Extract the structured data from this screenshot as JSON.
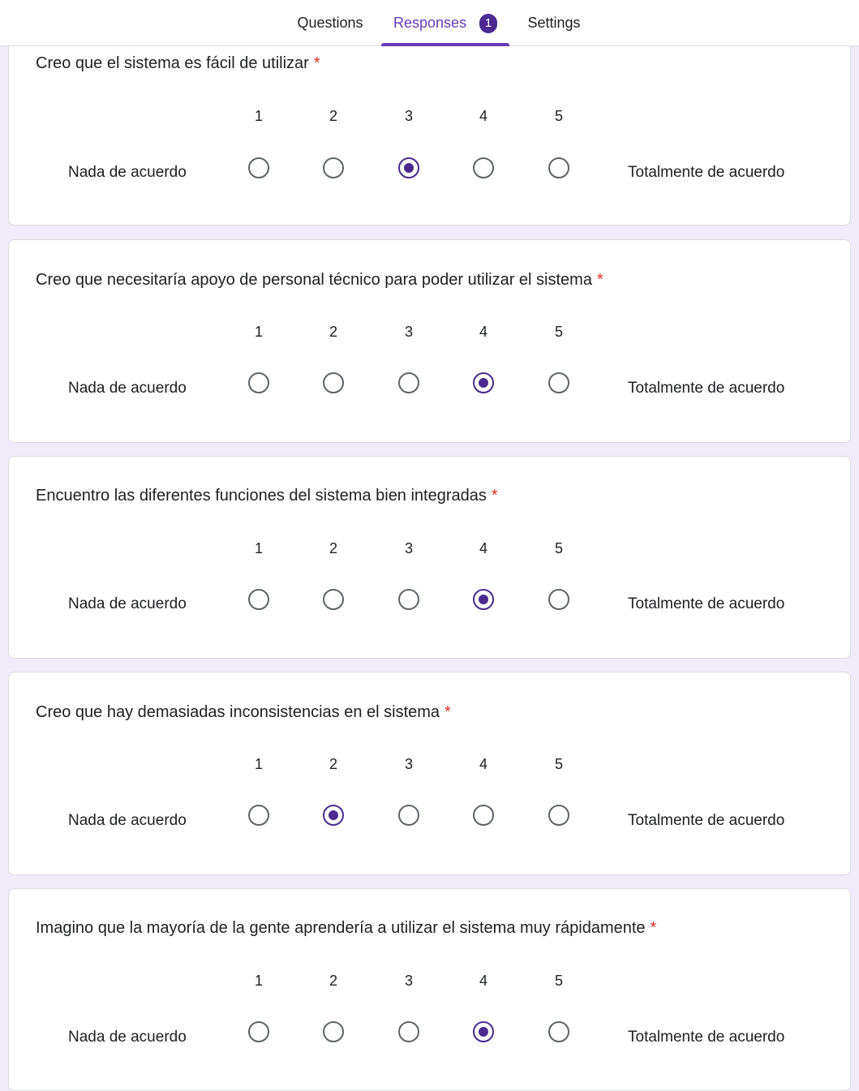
{
  "tabs": {
    "questions": "Questions",
    "responses": "Responses",
    "responses_count": "1",
    "settings": "Settings"
  },
  "scale": {
    "numbers": [
      "1",
      "2",
      "3",
      "4",
      "5"
    ],
    "low_label": "Nada de acuerdo",
    "high_label": "Totalmente de acuerdo",
    "required_mark": "*"
  },
  "questions": [
    {
      "title": "Creo que el sistema es fácil de utilizar",
      "selected": 3
    },
    {
      "title": "Creo que necesitaría apoyo de personal técnico para poder utilizar el sistema",
      "selected": 4
    },
    {
      "title": "Encuentro las diferentes funciones del sistema bien integradas",
      "selected": 4
    },
    {
      "title": "Creo que hay demasiadas inconsistencias en el sistema",
      "selected": 2
    },
    {
      "title": "Imagino que la mayoría de la gente aprendería a utilizar el sistema muy rápidamente",
      "selected": 4
    }
  ],
  "colors": {
    "accent": "#673ab7",
    "selected_radio": "#4a2a8f",
    "required": "#d93025",
    "page_background": "#f0ebf8"
  }
}
